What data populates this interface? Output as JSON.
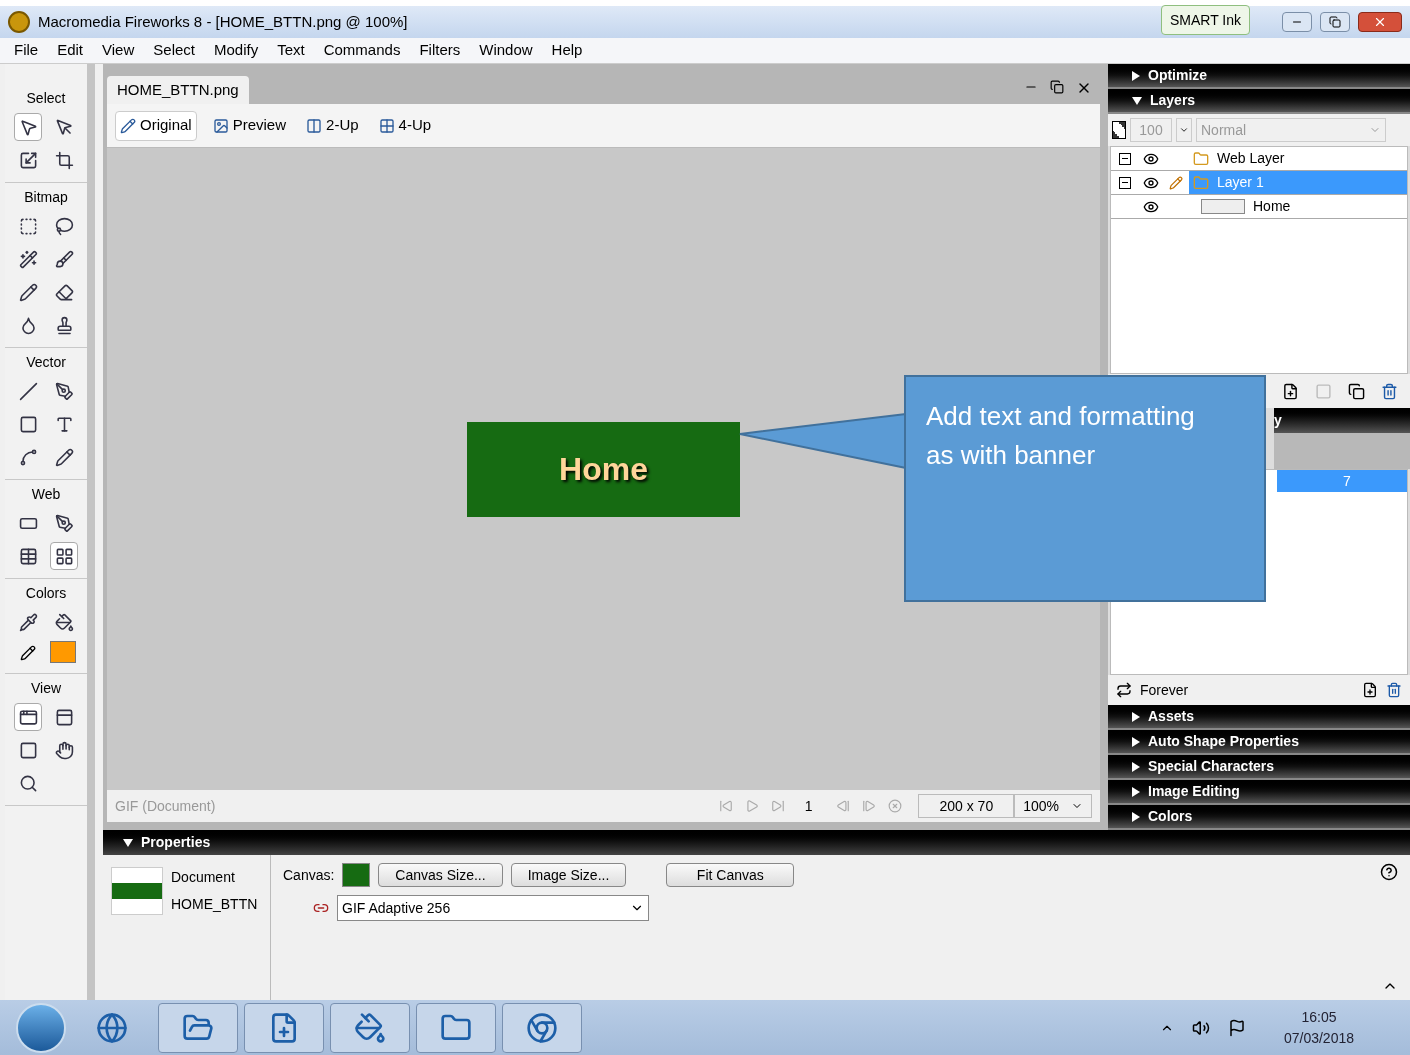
{
  "window": {
    "title": "Macromedia Fireworks 8 - [HOME_BTTN.png @ 100%]",
    "smart_ink": "SMART Ink"
  },
  "menu": [
    "File",
    "Edit",
    "View",
    "Select",
    "Modify",
    "Text",
    "Commands",
    "Filters",
    "Window",
    "Help"
  ],
  "tool_groups": [
    {
      "title": "Select",
      "tools": [
        {
          "selected": true
        },
        {
          "selected": false
        },
        {
          "selected": false
        },
        {
          "selected": false
        }
      ]
    },
    {
      "title": "Bitmap",
      "tools": [
        {
          "selected": false
        },
        {
          "selected": false
        },
        {
          "selected": false
        },
        {
          "selected": false
        },
        {
          "selected": false
        },
        {
          "selected": false
        },
        {
          "selected": false
        },
        {
          "selected": false
        }
      ]
    },
    {
      "title": "Vector",
      "tools": [
        {
          "selected": false
        },
        {
          "selected": false
        },
        {
          "selected": false
        },
        {
          "selected": false
        },
        {
          "selected": false
        },
        {
          "selected": false
        }
      ]
    },
    {
      "title": "Web",
      "tools": [
        {
          "selected": false
        },
        {
          "selected": false
        },
        {
          "selected": false
        },
        {
          "selected": true
        }
      ]
    },
    {
      "title": "Colors",
      "tools": [
        {
          "selected": false
        },
        {
          "selected": false
        }
      ]
    },
    {
      "title": "View",
      "tools": [
        {
          "selected": true
        },
        {
          "selected": false
        },
        {
          "selected": false
        },
        {
          "selected": false
        },
        {
          "selected": false
        }
      ]
    }
  ],
  "document": {
    "tab": "HOME_BTTN.png",
    "views": [
      {
        "label": "Original",
        "selected": true
      },
      {
        "label": "Preview",
        "selected": false
      },
      {
        "label": "2-Up",
        "selected": false
      },
      {
        "label": "4-Up",
        "selected": false
      }
    ],
    "canvas_button": "Home",
    "status": {
      "format": "GIF (Document)",
      "frame": "1",
      "size": "200 x 70",
      "zoom": "100%"
    }
  },
  "callout": "Add text and formatting as with banner",
  "panels": [
    {
      "title": "Optimize",
      "expanded": false
    }
  ],
  "layers": {
    "title": "Layers",
    "expanded": true,
    "opacity": "100",
    "blend": "Normal",
    "rows": [
      {
        "kind": "layer",
        "name": "Web Layer",
        "expanded": true,
        "selected": false,
        "editing": false
      },
      {
        "kind": "layer",
        "name": "Layer 1",
        "expanded": true,
        "selected": true,
        "editing": true
      },
      {
        "kind": "object",
        "name": "Home",
        "selected": false,
        "editing": false
      }
    ]
  },
  "frames": {
    "title_fragment": "y",
    "rows": [
      {
        "number": "7",
        "selected": true
      }
    ],
    "loop": "Forever"
  },
  "collapsed_panels": [
    {
      "title": "Assets",
      "expanded": false
    },
    {
      "title": "Auto Shape Properties",
      "expanded": false
    },
    {
      "title": "Special Characters",
      "expanded": false
    },
    {
      "title": "Image Editing",
      "expanded": false
    },
    {
      "title": "Colors",
      "expanded": false
    }
  ],
  "properties": {
    "title": "Properties",
    "expanded": true,
    "type": "Document",
    "name": "HOME_BTTN",
    "canvas_label": "Canvas:",
    "buttons": [
      "Canvas Size...",
      "Image Size...",
      "Fit Canvas"
    ],
    "palette": "GIF Adaptive 256"
  },
  "taskbar": {
    "time": "16:05",
    "date": "07/03/2018"
  }
}
